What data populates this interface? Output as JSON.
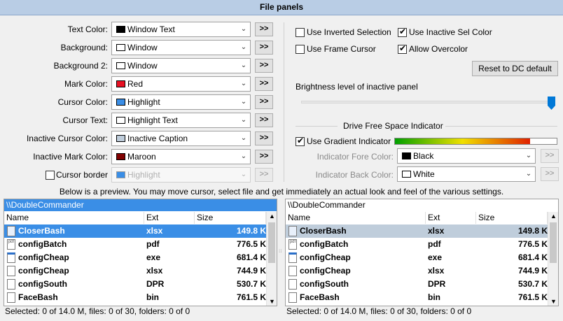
{
  "header": {
    "title": "File panels"
  },
  "colors": [
    {
      "label": "Text Color:",
      "value": "Window Text",
      "swatch": "#000000",
      "disabled": false,
      "button": ">>"
    },
    {
      "label": "Background:",
      "value": "Window",
      "swatch": "#ffffff",
      "disabled": false,
      "button": ">>"
    },
    {
      "label": "Background 2:",
      "value": "Window",
      "swatch": "#ffffff",
      "disabled": false,
      "button": ">>"
    },
    {
      "label": "Mark Color:",
      "value": "Red",
      "swatch": "#e81123",
      "disabled": false,
      "button": ">>"
    },
    {
      "label": "Cursor Color:",
      "value": "Highlight",
      "swatch": "#3a8ee6",
      "disabled": false,
      "button": ">>"
    },
    {
      "label": "Cursor Text:",
      "value": "Highlight Text",
      "swatch": "#ffffff",
      "disabled": false,
      "button": ">>"
    },
    {
      "label": "Inactive Cursor Color:",
      "value": "Inactive Caption",
      "swatch": "#bfcddb",
      "disabled": false,
      "button": ">>"
    },
    {
      "label": "Inactive Mark Color:",
      "value": "Maroon",
      "swatch": "#800000",
      "disabled": false,
      "button": ">>"
    },
    {
      "label": "Cursor border",
      "value": "Highlight",
      "swatch": "#3a8ee6",
      "disabled": true,
      "button": ">>"
    }
  ],
  "options": {
    "use_inverted_selection": "Use Inverted Selection",
    "use_inactive_sel_color": "Use Inactive Sel Color",
    "use_frame_cursor": "Use Frame Cursor",
    "allow_overcolor": "Allow Overcolor",
    "reset_button": "Reset to DC default",
    "brightness_label": "Brightness level of inactive panel",
    "brightness_value": 1.0,
    "drive_indicator_title": "Drive Free Space Indicator",
    "use_gradient_indicator": "Use Gradient Indicator",
    "indicator_fore_label": "Indicator Fore Color:",
    "indicator_fore_value": "Black",
    "indicator_fore_swatch": "#000000",
    "indicator_back_label": "Indicator Back Color:",
    "indicator_back_value": "White",
    "indicator_back_swatch": "#ffffff",
    "more_button": ">>"
  },
  "checks": {
    "cursor_border": false,
    "use_inverted_selection": false,
    "use_inactive_sel_color": true,
    "use_frame_cursor": false,
    "allow_overcolor": true,
    "use_gradient_indicator": true
  },
  "preview_note": "Below is a preview. You may move cursor, select file and get immediately an actual look and feel of the various settings.",
  "panels": [
    {
      "path": "\\\\DoubleCommander",
      "columns": [
        "Name",
        "Ext",
        "Size"
      ],
      "rows": [
        {
          "name": "CloserBash",
          "ext": "xlsx",
          "size": "149.8 K",
          "icon": "spreadsheet"
        },
        {
          "name": "configBatch",
          "ext": "pdf",
          "size": "776.5 K",
          "icon": "pdf"
        },
        {
          "name": "configCheap",
          "ext": "exe",
          "size": "681.4 K",
          "icon": "exe"
        },
        {
          "name": "configCheap",
          "ext": "xlsx",
          "size": "744.9 K",
          "icon": "file"
        },
        {
          "name": "configSouth",
          "ext": "DPR",
          "size": "530.7 K",
          "icon": "file"
        },
        {
          "name": "FaceBash",
          "ext": "bin",
          "size": "761.5 K",
          "icon": "file"
        }
      ],
      "status": "Selected: 0 of 14.0 M, files: 0 of 30, folders: 0 of 0"
    },
    {
      "path": "\\\\DoubleCommander",
      "columns": [
        "Name",
        "Ext",
        "Size"
      ],
      "rows": [
        {
          "name": "CloserBash",
          "ext": "xlsx",
          "size": "149.8 K",
          "icon": "spreadsheet"
        },
        {
          "name": "configBatch",
          "ext": "pdf",
          "size": "776.5 K",
          "icon": "pdf"
        },
        {
          "name": "configCheap",
          "ext": "exe",
          "size": "681.4 K",
          "icon": "exe"
        },
        {
          "name": "configCheap",
          "ext": "xlsx",
          "size": "744.9 K",
          "icon": "file"
        },
        {
          "name": "configSouth",
          "ext": "DPR",
          "size": "530.7 K",
          "icon": "file"
        },
        {
          "name": "FaceBash",
          "ext": "bin",
          "size": "761.5 K",
          "icon": "file"
        }
      ],
      "status": "Selected: 0 of 14.0 M, files: 0 of 30, folders: 0 of 0"
    }
  ],
  "accent": {
    "active_path_bg": "#3a8ee6",
    "active_cursor_bg": "#3a8ee6",
    "inactive_path_bg": "#ffffff",
    "inactive_cursor_bg": "#bfcddb"
  }
}
